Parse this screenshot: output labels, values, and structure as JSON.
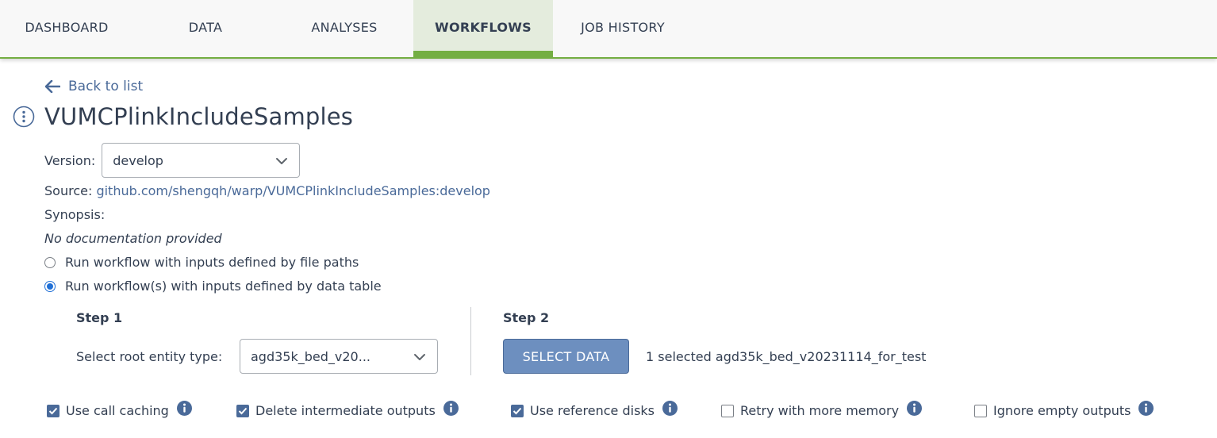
{
  "tabs": [
    {
      "label": "DASHBOARD",
      "active": false
    },
    {
      "label": "DATA",
      "active": false
    },
    {
      "label": "ANALYSES",
      "active": false
    },
    {
      "label": "WORKFLOWS",
      "active": true
    },
    {
      "label": "JOB HISTORY",
      "active": false
    }
  ],
  "back_link": "Back to list",
  "workflow_name": "VUMCPlinkIncludeSamples",
  "version": {
    "label": "Version:",
    "value": "develop"
  },
  "source": {
    "label": "Source:",
    "value": "github.com/shengqh/warp/VUMCPlinkIncludeSamples:develop"
  },
  "synopsis": {
    "label": "Synopsis:",
    "value": "No documentation provided"
  },
  "run_modes": [
    {
      "label": "Run workflow with inputs defined by file paths",
      "selected": false
    },
    {
      "label": "Run workflow(s) with inputs defined by data table",
      "selected": true
    }
  ],
  "step1": {
    "heading": "Step 1",
    "root_entity_label": "Select root entity type:",
    "root_entity_value": "agd35k_bed_v20..."
  },
  "step2": {
    "heading": "Step 2",
    "button_label": "SELECT DATA",
    "selection_summary": "1 selected agd35k_bed_v20231114_for_test"
  },
  "options": [
    {
      "label": "Use call caching",
      "checked": true
    },
    {
      "label": "Delete intermediate outputs",
      "checked": true
    },
    {
      "label": "Use reference disks",
      "checked": true
    },
    {
      "label": "Retry with more memory",
      "checked": false
    },
    {
      "label": "Ignore empty outputs",
      "checked": false
    }
  ],
  "colors": {
    "accent_green": "#74ae43",
    "link_blue": "#4a6a99",
    "button_blue": "#6d8fbf",
    "radio_blue": "#1f6fd6"
  },
  "icons": [
    "arrow-left-icon",
    "info-circle-icon",
    "chevron-down-icon",
    "checkmark-icon",
    "info-icon"
  ]
}
